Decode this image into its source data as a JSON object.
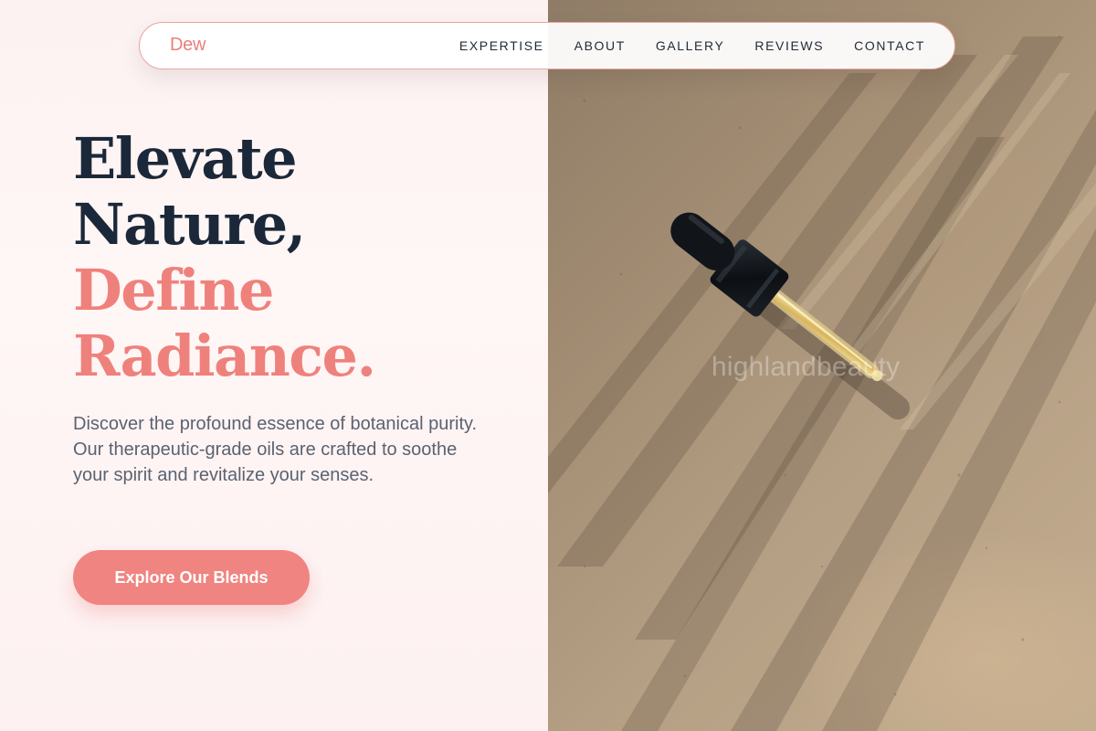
{
  "brand": {
    "logo": "Dew"
  },
  "nav": {
    "links": [
      "EXPERTISE",
      "ABOUT",
      "GALLERY",
      "REVIEWS",
      "CONTACT"
    ]
  },
  "hero": {
    "headline_lines": [
      {
        "text": "Elevate",
        "color": "#1b2839"
      },
      {
        "text": "Nature,",
        "color": "#1b2839"
      },
      {
        "text": "Define",
        "color": "#ef817c"
      },
      {
        "text": "Radiance.",
        "color": "#ef817c"
      }
    ],
    "description": "Discover the profound essence of botanical purity. Our therapeutic-grade oils are crafted to soothe your spirit and revitalize your senses.",
    "cta_label": "Explore Our Blends"
  },
  "image": {
    "watermark": "highlandbeauty",
    "subject": "dropper-bottle-cap"
  },
  "colors": {
    "accent": "#f08480",
    "heading": "#1b2839",
    "body_text": "#5b6270",
    "left_background": "#fdf2f2"
  }
}
